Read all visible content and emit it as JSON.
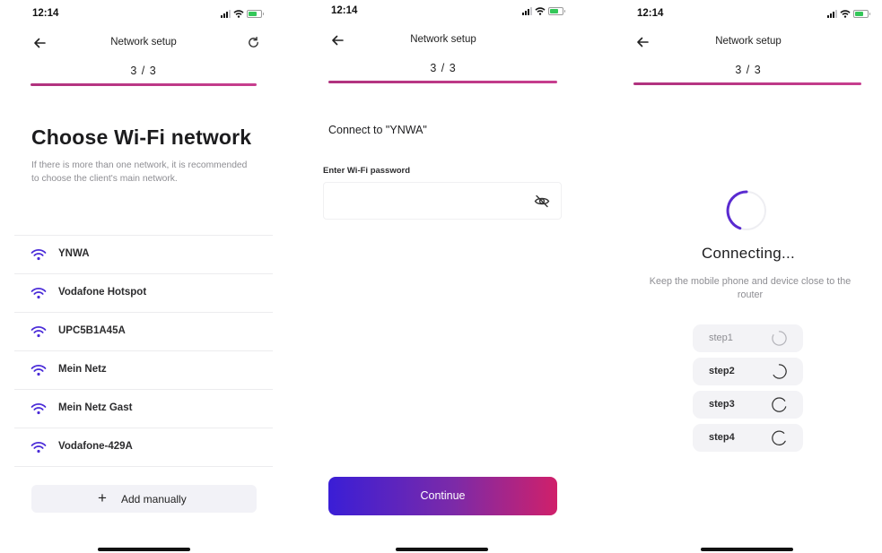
{
  "status_bar": {
    "time": "12:14"
  },
  "screens": [
    {
      "header": {
        "title": "Network setup",
        "step": "3 / 3"
      },
      "heading": "Choose Wi-Fi network",
      "hint": "If there is more than one network, it is recommended to choose the client's main network.",
      "networks": [
        {
          "name": "YNWA"
        },
        {
          "name": "Vodafone Hotspot"
        },
        {
          "name": "UPC5B1A45A"
        },
        {
          "name": "Mein Netz"
        },
        {
          "name": "Mein Netz Gast"
        },
        {
          "name": "Vodafone-429A"
        }
      ],
      "add_button": {
        "icon": "+",
        "label": "Add manually"
      }
    },
    {
      "header": {
        "title": "Network setup",
        "step": "3 / 3"
      },
      "connect_to": "Connect to \"YNWA\"",
      "password": {
        "label": "Enter Wi-Fi password",
        "value": "",
        "placeholder": ""
      },
      "continue_button": {
        "label": "Continue"
      }
    },
    {
      "header": {
        "title": "Network setup",
        "step": "3 / 3"
      },
      "status": "Connecting...",
      "hint": "Keep the mobile phone and device close to the router",
      "steps": [
        {
          "label": "step1"
        },
        {
          "label": "step2"
        },
        {
          "label": "step3"
        },
        {
          "label": "step4"
        }
      ]
    }
  ],
  "icons": {
    "back": "arrow-left-icon",
    "refresh": "refresh-icon",
    "wifi": "wifi-icon",
    "eye": "eye-off-icon",
    "add": "plus-icon",
    "spinner": "loading-spinner-icon"
  },
  "colors": {
    "accent_progress": "#b8337f",
    "wifi_icon": "#4a2bd8",
    "button_gradient_start": "#3a1ed6",
    "button_gradient_end": "#d0206a",
    "spinner": "#5a2bd0",
    "secondary_text": "#8e8e93"
  }
}
